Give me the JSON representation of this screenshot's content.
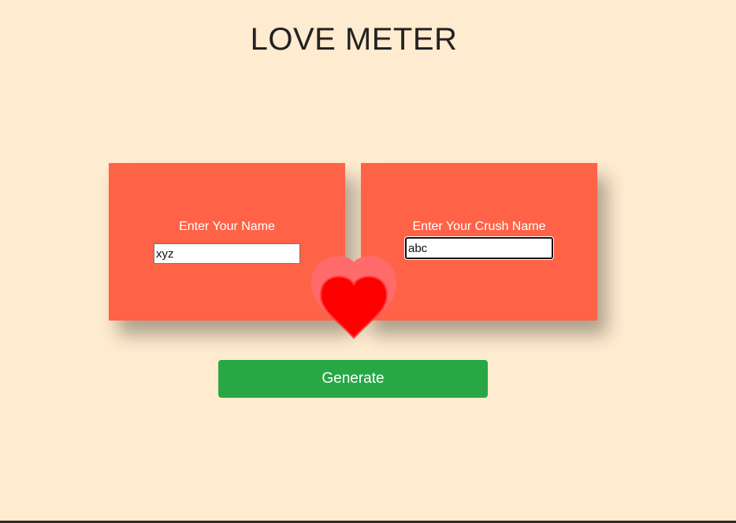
{
  "page": {
    "title": "LOVE METER"
  },
  "form": {
    "your_name_label": "Enter Your Name",
    "your_name_value": "xyz",
    "crush_name_label": "Enter Your Crush Name",
    "crush_name_value": "abc",
    "generate_label": "Generate"
  },
  "icons": {
    "center": "heart-icon"
  },
  "colors": {
    "background": "#ffebcf",
    "card": "#ff6347",
    "heart": "#ff0000",
    "heart_glow": "#ff6b6b",
    "button": "#28a745"
  }
}
